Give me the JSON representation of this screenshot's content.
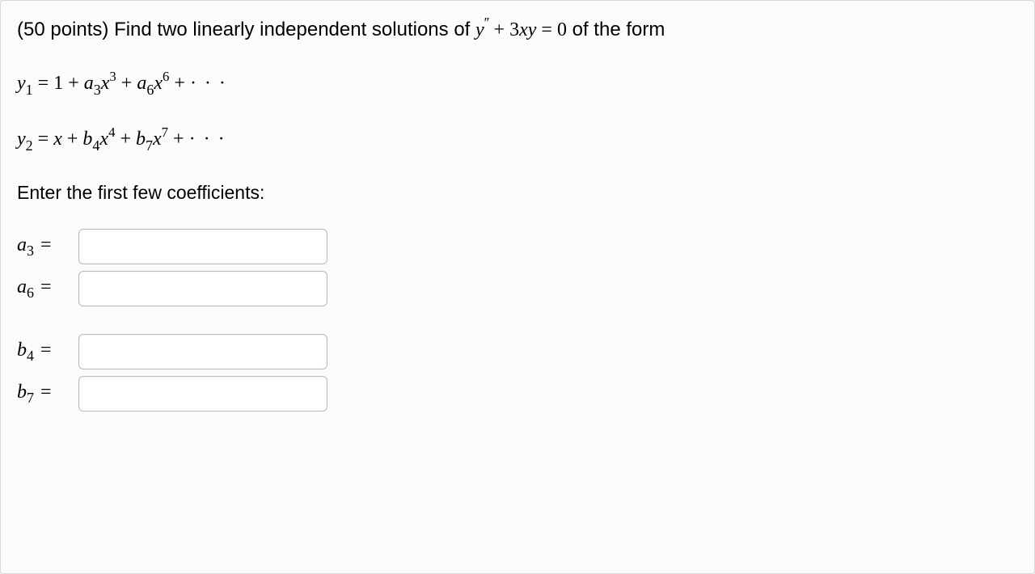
{
  "question": {
    "points_prefix": "(50 points) ",
    "text_part1": "Find two linearly independent solutions of ",
    "text_part2": " of the form",
    "eq_lhs": "y′′ + 3xy = 0"
  },
  "series": {
    "y1_label": "y",
    "y1_sub": "1",
    "y1_rhs": " = 1 + a₃x³ + a₆x⁶ + · · ·",
    "y2_label": "y",
    "y2_sub": "2",
    "y2_rhs": " = x + b₄x⁴ + b₇x⁷ + · · ·"
  },
  "instruction": "Enter the first few coefficients:",
  "coefficients": {
    "a3": {
      "var": "a",
      "sub": "3",
      "value": ""
    },
    "a6": {
      "var": "a",
      "sub": "6",
      "value": ""
    },
    "b4": {
      "var": "b",
      "sub": "4",
      "value": ""
    },
    "b7": {
      "var": "b",
      "sub": "7",
      "value": ""
    }
  }
}
